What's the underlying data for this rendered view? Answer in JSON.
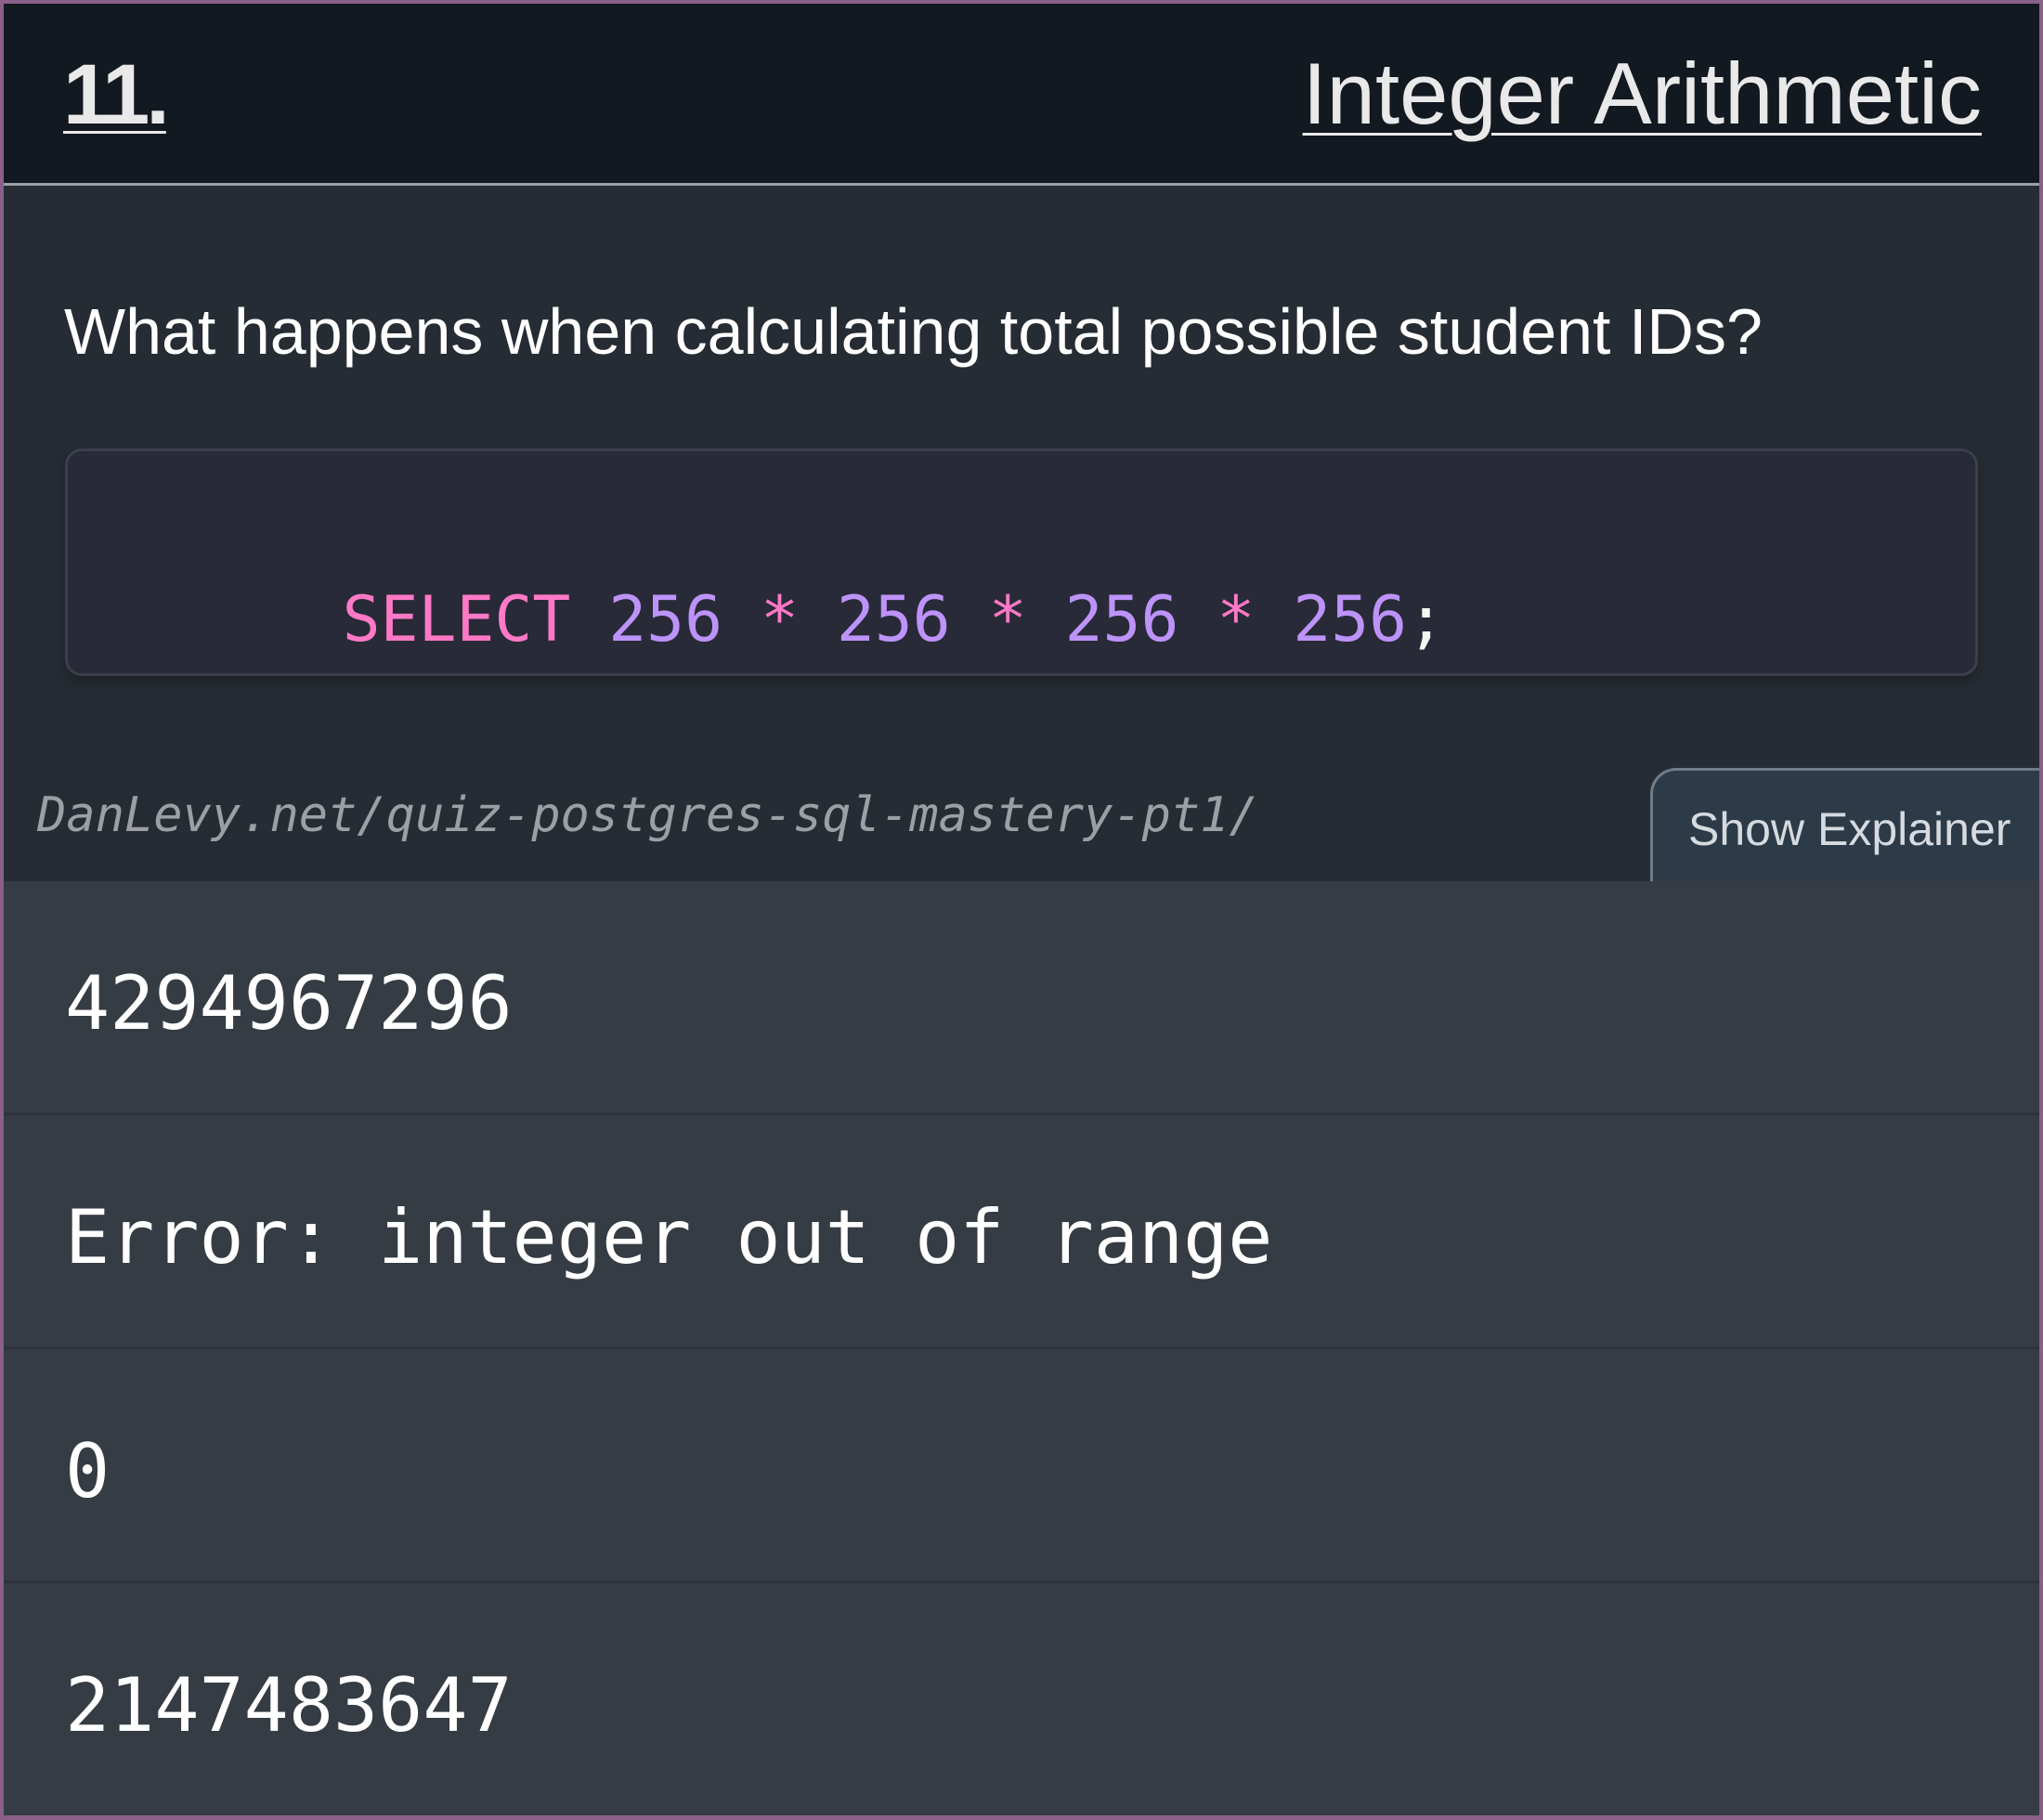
{
  "header": {
    "number": "11.",
    "title": "Integer Arithmetic"
  },
  "question": "What happens when calculating total possible student IDs?",
  "code": {
    "tokens": [
      {
        "text": "SELECT",
        "kind": "kw"
      },
      {
        "text": " ",
        "kind": "punc"
      },
      {
        "text": "256",
        "kind": "num"
      },
      {
        "text": " ",
        "kind": "punc"
      },
      {
        "text": "*",
        "kind": "op"
      },
      {
        "text": " ",
        "kind": "punc"
      },
      {
        "text": "256",
        "kind": "num"
      },
      {
        "text": " ",
        "kind": "punc"
      },
      {
        "text": "*",
        "kind": "op"
      },
      {
        "text": " ",
        "kind": "punc"
      },
      {
        "text": "256",
        "kind": "num"
      },
      {
        "text": " ",
        "kind": "punc"
      },
      {
        "text": "*",
        "kind": "op"
      },
      {
        "text": " ",
        "kind": "punc"
      },
      {
        "text": "256",
        "kind": "num"
      },
      {
        "text": ";",
        "kind": "punc"
      }
    ]
  },
  "source_url": "DanLevy.net/quiz-postgres-sql-mastery-pt1/",
  "explainer_button": "Show Explainer",
  "answers": [
    "4294967296",
    "Error: integer out of range",
    "0",
    "2147483647"
  ],
  "colors": {
    "keyword": "#ff79c6",
    "number": "#bd93f9",
    "background": "#262c33",
    "answer_bg": "#353c44"
  }
}
